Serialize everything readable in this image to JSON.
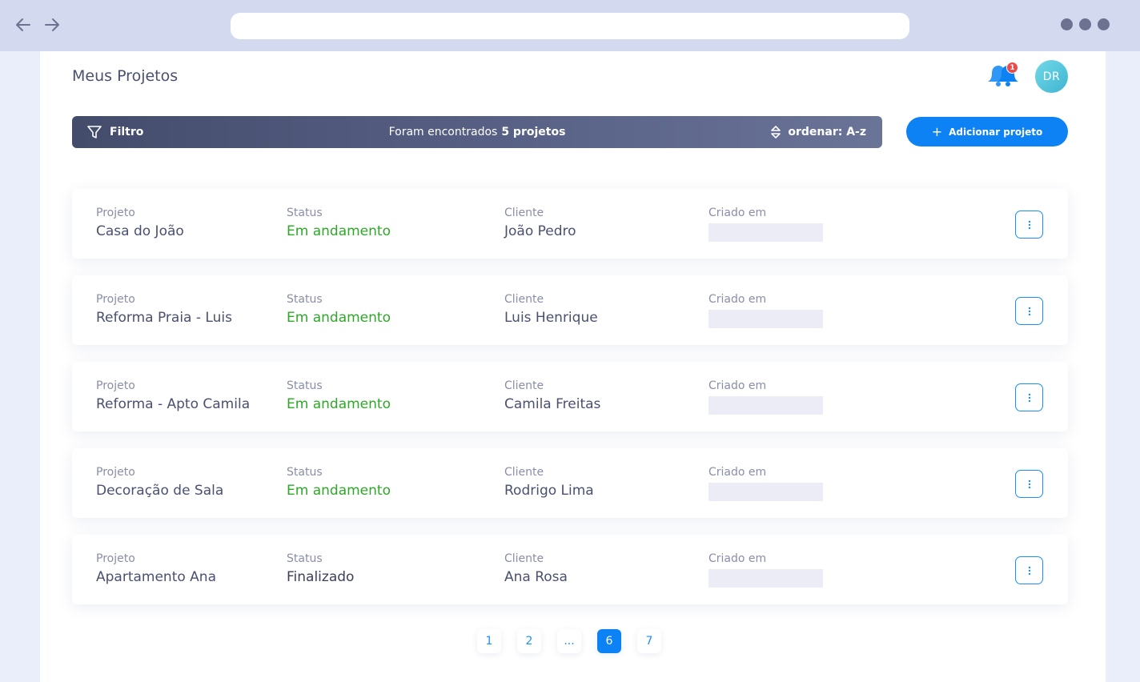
{
  "browser": {
    "address_value": ""
  },
  "header": {
    "title": "Meus Projetos",
    "notifications_count": "1",
    "avatar_initials": "DR"
  },
  "toolbar": {
    "filter_label": "Filtro",
    "results_prefix": "Foram encontrados",
    "results_count": "5 projetos",
    "sort_label": "ordenar: A-z",
    "add_label": "Adicionar projeto"
  },
  "columns": {
    "project": "Projeto",
    "status": "Status",
    "client": "Cliente",
    "created": "Criado em"
  },
  "projects": [
    {
      "name": "Casa do João",
      "status": "Em andamento",
      "client": "João Pedro"
    },
    {
      "name": "Reforma Praia - Luis",
      "status": "Em andamento",
      "client": "Luis Henrique"
    },
    {
      "name": "Reforma - Apto Camila",
      "status": "Em andamento",
      "client": "Camila Freitas"
    },
    {
      "name": "Decoração de Sala",
      "status": "Em andamento",
      "client": "Rodrigo Lima"
    },
    {
      "name": "Apartamento Ana",
      "status": "Finalizado",
      "client": "Ana Rosa"
    }
  ],
  "pagination": {
    "pages": [
      "1",
      "2",
      "...",
      "6",
      "7"
    ],
    "active": "6"
  },
  "colors": {
    "accent": "#0c82f4",
    "status_active": "#2ea828",
    "badge": "#ea4a4a"
  },
  "icons": {
    "back": "arrow-left-icon",
    "forward": "arrow-right-icon",
    "filter": "funnel-icon",
    "sort": "sort-arrows-icon",
    "bell": "bell-icon",
    "more": "vertical-dots-icon"
  }
}
